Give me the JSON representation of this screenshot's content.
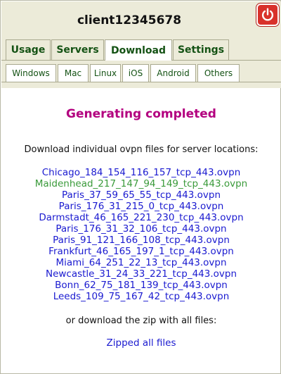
{
  "header": {
    "client_id": "client12345678",
    "power_color": "#d8312b"
  },
  "tabs": [
    {
      "label": "Usage",
      "active": false
    },
    {
      "label": "Servers",
      "active": false
    },
    {
      "label": "Download",
      "active": true
    },
    {
      "label": "Settings",
      "active": false
    }
  ],
  "subtabs": [
    {
      "label": "Windows"
    },
    {
      "label": "Mac"
    },
    {
      "label": "Linux"
    },
    {
      "label": "iOS"
    },
    {
      "label": "Android"
    },
    {
      "label": "Others"
    }
  ],
  "main": {
    "status": "Generating completed",
    "instructions": "Download individual ovpn files for server locations:",
    "files": [
      {
        "name": "Chicago_184_154_116_157_tcp_443.ovpn",
        "visited": false
      },
      {
        "name": "Maidenhead_217_147_94_149_tcp_443.ovpn",
        "visited": true
      },
      {
        "name": "Paris_37_59_65_55_tcp_443.ovpn",
        "visited": false
      },
      {
        "name": "Paris_176_31_215_0_tcp_443.ovpn",
        "visited": false
      },
      {
        "name": "Darmstadt_46_165_221_230_tcp_443.ovpn",
        "visited": false
      },
      {
        "name": "Paris_176_31_32_106_tcp_443.ovpn",
        "visited": false
      },
      {
        "name": "Paris_91_121_166_108_tcp_443.ovpn",
        "visited": false
      },
      {
        "name": "Frankfurt_46_165_197_1_tcp_443.ovpn",
        "visited": false
      },
      {
        "name": "Miami_64_251_22_13_tcp_443.ovpn",
        "visited": false
      },
      {
        "name": "Newcastle_31_24_33_221_tcp_443.ovpn",
        "visited": false
      },
      {
        "name": "Bonn_62_75_181_139_tcp_443.ovpn",
        "visited": false
      },
      {
        "name": "Leeds_109_75_167_42_tcp_443.ovpn",
        "visited": false
      }
    ],
    "zip_text": "or download the zip with all files:",
    "zip_link": "Zipped all files"
  }
}
